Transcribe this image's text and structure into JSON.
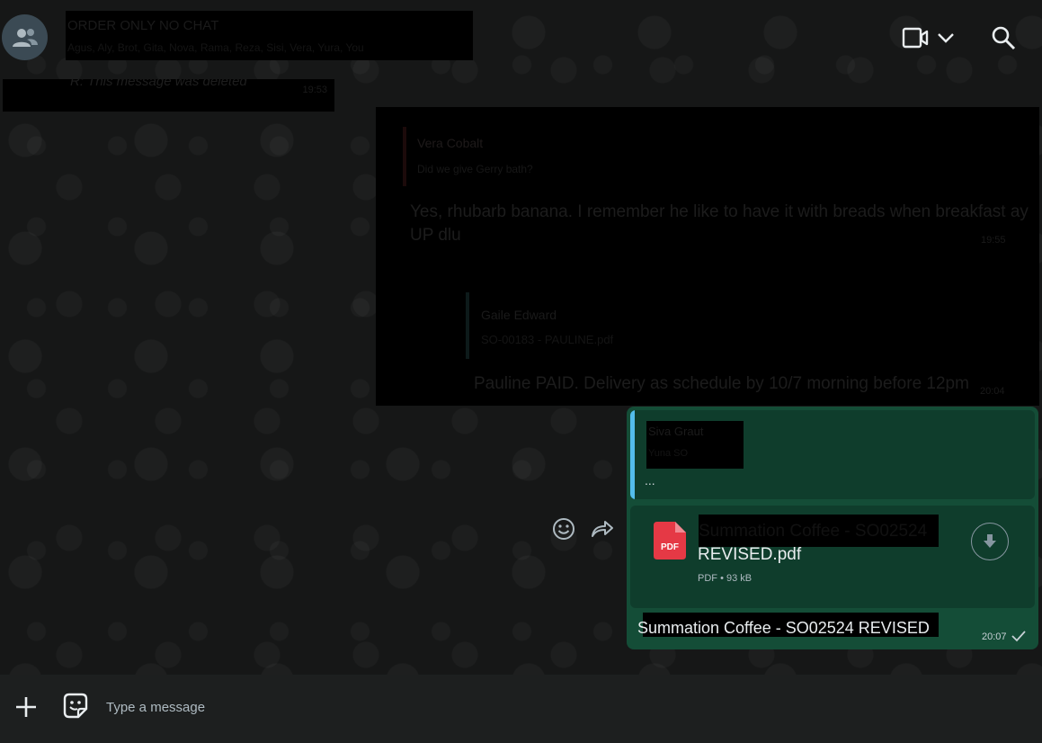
{
  "header": {
    "group_name": "ORDER ONLY NO CHAT",
    "participants": "Agus, Aly, Brot, Gita, Nova, Rama, Reza, Sisi, Vera, Yura, You"
  },
  "deleted_message": {
    "author_prefix": "R:",
    "text": "This message was deleted",
    "time": "19:53"
  },
  "redacted_messages": {
    "quote1_author": "Vera Cobalt",
    "quote1_text": "Did we give Gerry bath?",
    "message1": "Yes, rhubarb banana. I remember he like to have it with breads when breakfast ay UP dlu",
    "time1": "19:55",
    "quote2_author": "Gaile Edward",
    "quote2_text": "SO-00183 - PAULINE.pdf",
    "message2": "Pauline PAID. Delivery as schedule by 10/7 morning before 12pm",
    "time2": "20:04"
  },
  "outgoing": {
    "quote_author": "Siva Graut",
    "quote_subtitle": "Yuna SO",
    "quote_text": "...",
    "doc_name_line1": "Summation Coffee - SO02524",
    "doc_name_line2": "REVISED.pdf",
    "doc_type": "PDF",
    "doc_size": "93 kB",
    "doc_meta_sep": "•",
    "pdf_label": "PDF",
    "caption": "Summation Coffee - SO02524 REVISED",
    "time": "20:07"
  },
  "composer": {
    "placeholder": "Type a message"
  },
  "icons": {
    "avatar": "group-icon",
    "video": "video-call-icon",
    "chevron": "chevron-down-icon",
    "search": "search-icon",
    "react": "emoji-icon",
    "forward": "forward-icon",
    "download": "download-icon",
    "plus": "plus-icon",
    "sticker": "sticker-icon",
    "check": "check-icon"
  },
  "colors": {
    "outgoing_bubble": "#144d37",
    "quote_bar": "#53bdeb",
    "pdf_red": "#e53945",
    "background": "#161717",
    "composer": "#1d1f1f"
  }
}
